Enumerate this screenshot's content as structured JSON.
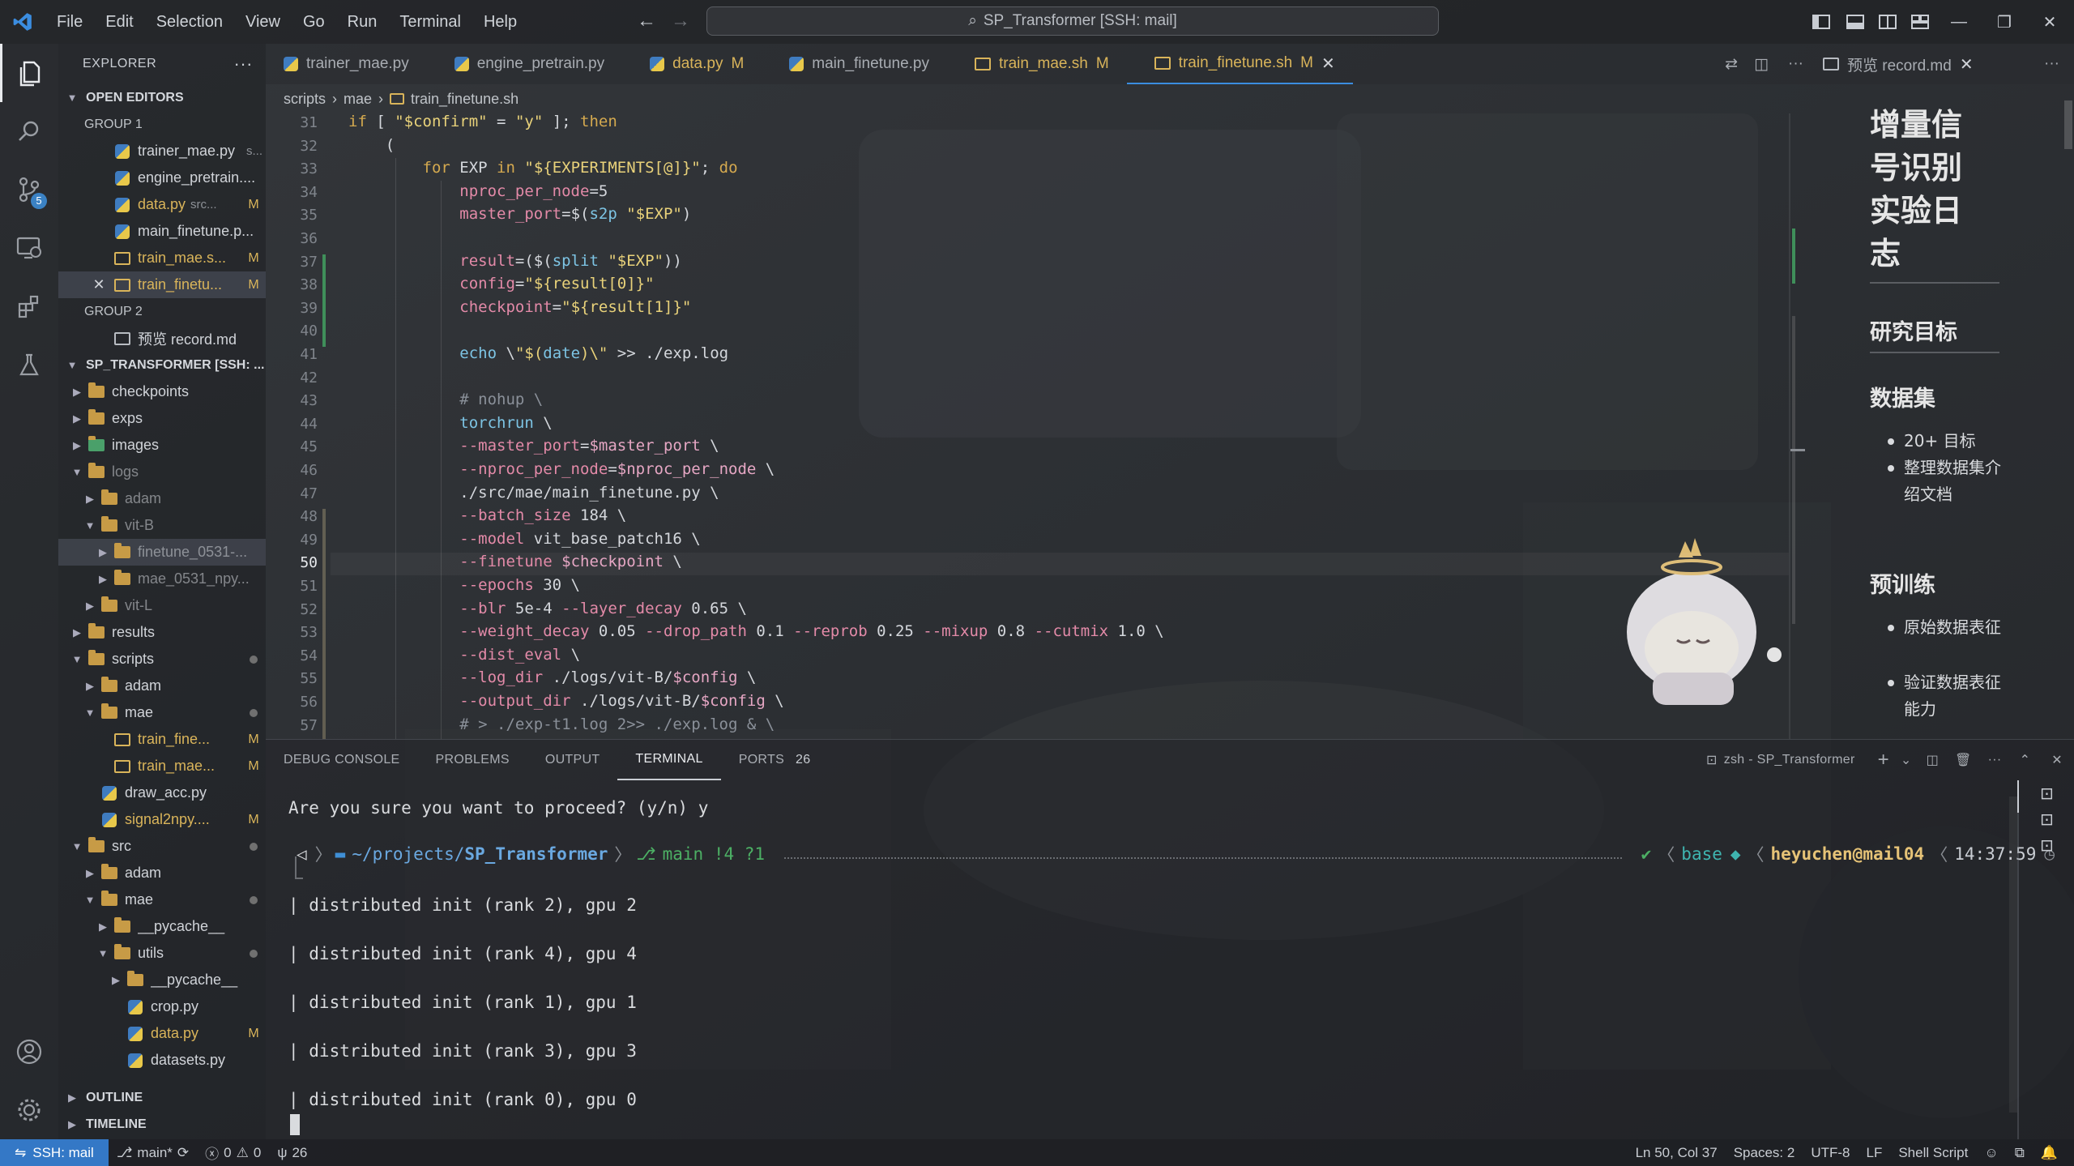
{
  "menu": [
    "File",
    "Edit",
    "Selection",
    "View",
    "Go",
    "Run",
    "Terminal",
    "Help"
  ],
  "command_center": "SP_Transformer [SSH: mail]",
  "sidebar": {
    "title": "EXPLORER",
    "open_editors": "OPEN EDITORS",
    "group1": "GROUP 1",
    "group2": "GROUP 2",
    "open_items": [
      {
        "name": "trainer_mae.py",
        "hint": "s...",
        "status": ""
      },
      {
        "name": "engine_pretrain....",
        "hint": "",
        "status": ""
      },
      {
        "name": "data.py",
        "hint": "src...",
        "status": "M"
      },
      {
        "name": "main_finetune.p...",
        "hint": "",
        "status": ""
      },
      {
        "name": "train_mae.s...",
        "hint": "",
        "status": "M"
      },
      {
        "name": "train_finetu...",
        "hint": "",
        "status": "M"
      },
      {
        "name": "预览 record.md",
        "hint": "",
        "status": ""
      }
    ],
    "project": "SP_TRANSFORMER [SSH: ...",
    "tree": [
      {
        "name": "checkpoints",
        "status": ""
      },
      {
        "name": "exps",
        "status": ""
      },
      {
        "name": "images",
        "status": ""
      },
      {
        "name": "logs",
        "status": ""
      },
      {
        "name": "adam",
        "status": ""
      },
      {
        "name": "vit-B",
        "status": ""
      },
      {
        "name": "finetune_0531-...",
        "status": ""
      },
      {
        "name": "mae_0531_npy...",
        "status": ""
      },
      {
        "name": "vit-L",
        "status": ""
      },
      {
        "name": "results",
        "status": ""
      },
      {
        "name": "scripts",
        "status": ""
      },
      {
        "name": "adam",
        "status": ""
      },
      {
        "name": "mae",
        "status": ""
      },
      {
        "name": "train_fine...",
        "status": "M"
      },
      {
        "name": "train_mae...",
        "status": "M"
      },
      {
        "name": "draw_acc.py",
        "status": ""
      },
      {
        "name": "signal2npy....",
        "status": "M"
      },
      {
        "name": "src",
        "status": ""
      },
      {
        "name": "adam",
        "status": ""
      },
      {
        "name": "mae",
        "status": ""
      },
      {
        "name": "__pycache__",
        "status": ""
      },
      {
        "name": "utils",
        "status": ""
      },
      {
        "name": "__pycache__",
        "status": ""
      },
      {
        "name": "crop.py",
        "status": ""
      },
      {
        "name": "data.py",
        "status": "M"
      },
      {
        "name": "datasets.py",
        "status": ""
      }
    ],
    "outline": "OUTLINE",
    "timeline": "TIMELINE"
  },
  "tabs": [
    {
      "name": "trainer_mae.py",
      "status": ""
    },
    {
      "name": "engine_pretrain.py",
      "status": ""
    },
    {
      "name": "data.py",
      "status": "M"
    },
    {
      "name": "main_finetune.py",
      "status": ""
    },
    {
      "name": "train_mae.sh",
      "status": "M"
    },
    {
      "name": "train_finetune.sh",
      "status": "M"
    }
  ],
  "preview_tab": "预览 record.md",
  "breadcrumb": [
    "scripts",
    "mae",
    "train_finetune.sh"
  ],
  "editor": {
    "current_line": 50,
    "lines": [
      {
        "n": "31",
        "text": "if [ \"$confirm\" = \"y\" ]; then"
      },
      {
        "n": "32",
        "text": "    ("
      },
      {
        "n": "33",
        "text": "        for EXP in \"${EXPERIMENTS[@]}\"; do"
      },
      {
        "n": "34",
        "text": "            nproc_per_node=5"
      },
      {
        "n": "35",
        "text": "            master_port=$(s2p \"$EXP\")"
      },
      {
        "n": "36",
        "text": ""
      },
      {
        "n": "37",
        "text": "            result=($(split \"$EXP\"))"
      },
      {
        "n": "38",
        "text": "            config=\"${result[0]}\""
      },
      {
        "n": "39",
        "text": "            checkpoint=\"${result[1]}\""
      },
      {
        "n": "40",
        "text": ""
      },
      {
        "n": "41",
        "text": "            echo \\\"$(date)\\\" >> ./exp.log"
      },
      {
        "n": "42",
        "text": ""
      },
      {
        "n": "43",
        "text": "            # nohup \\"
      },
      {
        "n": "44",
        "text": "            torchrun \\"
      },
      {
        "n": "45",
        "text": "            --master_port=$master_port \\"
      },
      {
        "n": "46",
        "text": "            --nproc_per_node=$nproc_per_node \\"
      },
      {
        "n": "47",
        "text": "            ./src/mae/main_finetune.py \\"
      },
      {
        "n": "48",
        "text": "            --batch_size 184 \\"
      },
      {
        "n": "49",
        "text": "            --model vit_base_patch16 \\"
      },
      {
        "n": "50",
        "text": "            --finetune $checkpoint \\"
      },
      {
        "n": "51",
        "text": "            --epochs 30 \\"
      },
      {
        "n": "52",
        "text": "            --blr 5e-4 --layer_decay 0.65 \\"
      },
      {
        "n": "53",
        "text": "            --weight_decay 0.05 --drop_path 0.1 --reprob 0.25 --mixup 0.8 --cutmix 1.0 \\"
      },
      {
        "n": "54",
        "text": "            --dist_eval \\"
      },
      {
        "n": "55",
        "text": "            --log_dir ./logs/vit-B/$config \\"
      },
      {
        "n": "56",
        "text": "            --output_dir ./logs/vit-B/$config \\"
      },
      {
        "n": "57",
        "text": "            # > ./exp-t1.log 2>> ./exp.log & \\"
      }
    ]
  },
  "preview": {
    "title": "增量信号识别实验日志",
    "h_goal": "研究目标",
    "h_dataset": "数据集",
    "dataset_items": [
      "20+ 目标",
      "整理数据集介绍文档"
    ],
    "h_pretrain": "预训练",
    "pretrain_items": [
      "原始数据表征",
      "验证数据表征能力"
    ]
  },
  "panel": {
    "tabs": [
      "DEBUG CONSOLE",
      "PROBLEMS",
      "OUTPUT",
      "TERMINAL",
      "PORTS"
    ],
    "ports_count": "26",
    "shell": "zsh - SP_Transformer",
    "confirm_line": "Are you sure you want to proceed? (y/n) y",
    "prompt": {
      "path_prefix": "~/projects/",
      "path_dir": "SP_Transformer",
      "branch": "main !4 ?1",
      "env": "base",
      "user": "heyuchen@mail04",
      "time": "14:37:59"
    },
    "output": [
      "| distributed init (rank 2), gpu 2",
      "| distributed init (rank 4), gpu 4",
      "| distributed init (rank 1), gpu 1",
      "| distributed init (rank 3), gpu 3",
      "| distributed init (rank 0), gpu 0"
    ]
  },
  "status": {
    "remote": "SSH: mail",
    "branch": "main*",
    "errors": "0",
    "warnings": "0",
    "ports": "26",
    "position": "Ln 50, Col 37",
    "spaces": "Spaces: 2",
    "encoding": "UTF-8",
    "eol": "LF",
    "language": "Shell Script"
  },
  "colors": {
    "accent": "#3478c6",
    "modified": "#d9b45a",
    "keyword": "#d4a94f",
    "string": "#e9d27a",
    "variable": "#e38aa8"
  }
}
